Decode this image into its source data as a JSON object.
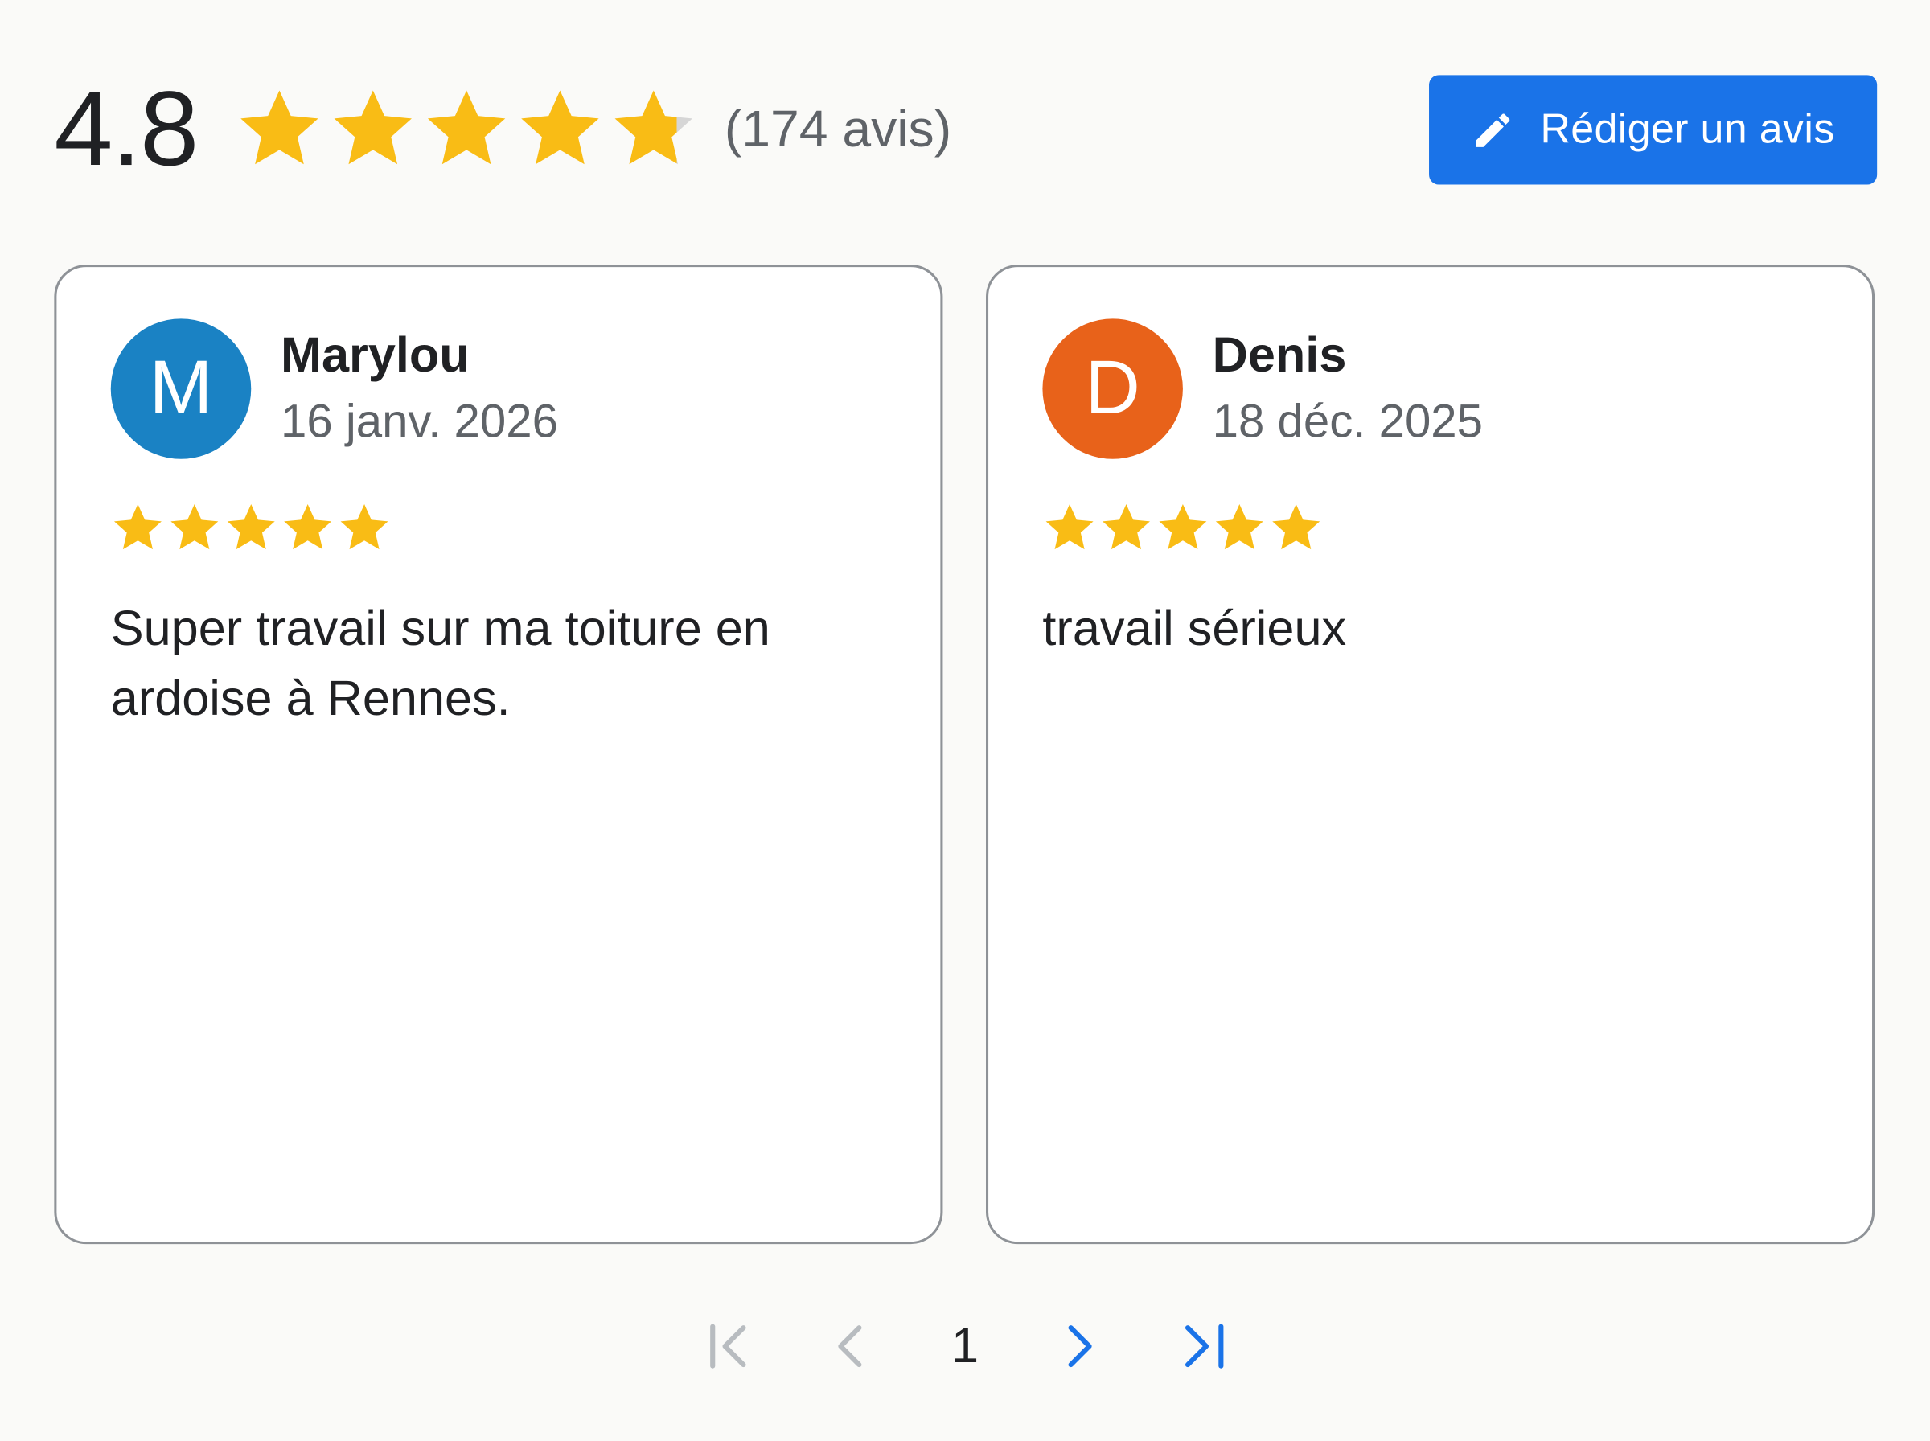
{
  "summary": {
    "rating": "4.8",
    "rating_value": 4.8,
    "rating_max": 5,
    "review_count": "(174 avis)",
    "star_color": "#f9bc15",
    "star_empty_color": "#d6d6d6"
  },
  "write_review": {
    "label": "Rédiger un avis",
    "icon": "pencil-icon",
    "background": "#1a73e8"
  },
  "reviews": [
    {
      "initial": "M",
      "avatar_color": "#1a82c4",
      "author": "Marylou",
      "date": "16 janv. 2026",
      "stars": 5,
      "text": "Super travail sur ma toiture en ardoise à Rennes."
    },
    {
      "initial": "D",
      "avatar_color": "#e8621a",
      "author": "Denis",
      "date": "18 déc. 2025",
      "stars": 5,
      "text": "travail sérieux"
    }
  ],
  "pagination": {
    "current_page": "1",
    "first_icon": "first-page-icon",
    "prev_icon": "chevron-left-icon",
    "next_icon": "chevron-right-icon",
    "last_icon": "last-page-icon",
    "disabled_color": "#b8bcc0",
    "active_color": "#1a73e8"
  }
}
